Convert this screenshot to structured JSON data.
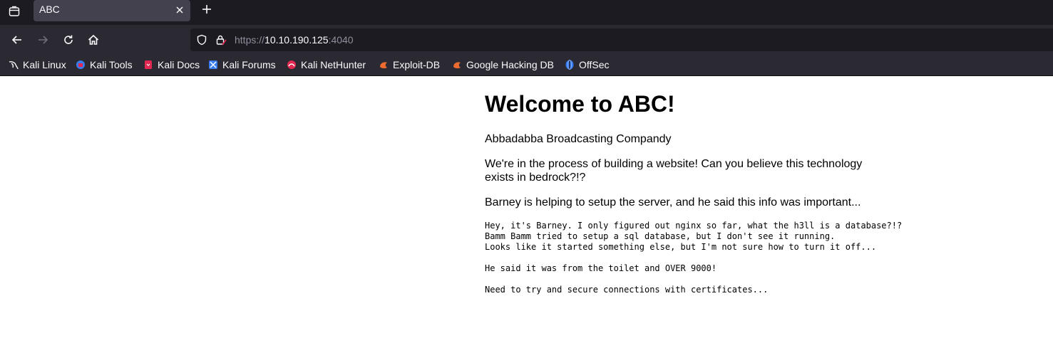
{
  "tab": {
    "title": "ABC"
  },
  "urlbar": {
    "scheme": "https://",
    "host": "10.10.190.125",
    "port": ":4040"
  },
  "bookmarks": [
    {
      "label": "Kali Linux",
      "icon": "kali-dragon-icon"
    },
    {
      "label": "Kali Tools",
      "icon": "kali-tools-icon"
    },
    {
      "label": "Kali Docs",
      "icon": "kali-docs-icon"
    },
    {
      "label": "Kali Forums",
      "icon": "kali-forums-icon"
    },
    {
      "label": "Kali NetHunter",
      "icon": "kali-nethunter-icon"
    },
    {
      "label": "Exploit-DB",
      "icon": "exploit-db-icon"
    },
    {
      "label": "Google Hacking DB",
      "icon": "ghdb-icon"
    },
    {
      "label": "OffSec",
      "icon": "offsec-icon"
    }
  ],
  "page": {
    "heading": "Welcome to ABC!",
    "subtitle": "Abbadabba Broadcasting Compandy",
    "para1": "We're in the process of building a website! Can you believe this technology exists in bedrock?!?",
    "para2": "Barney is helping to setup the server, and he said this info was important...",
    "note": "Hey, it's Barney. I only figured out nginx so far, what the h3ll is a database?!?\nBamm Bamm tried to setup a sql database, but I don't see it running.\nLooks like it started something else, but I'm not sure how to turn it off...\n\nHe said it was from the toilet and OVER 9000!\n\nNeed to try and secure connections with certificates..."
  },
  "colors": {
    "tabbar": "#1c1b22",
    "toolbar": "#2b2a33",
    "active_tab": "#42414d",
    "page_bg": "#ffffff"
  }
}
